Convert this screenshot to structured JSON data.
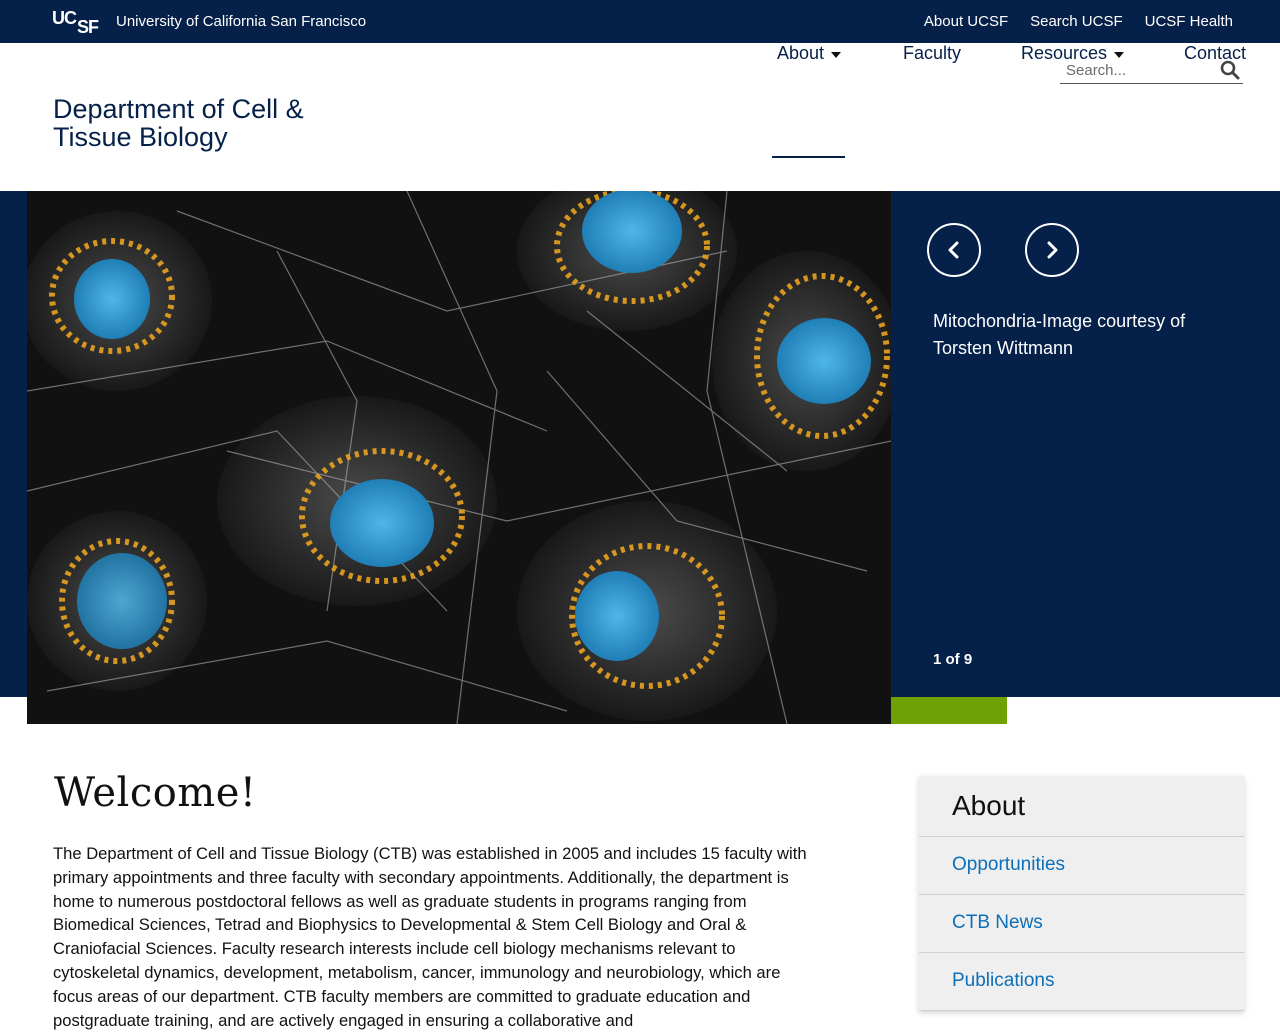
{
  "topbar": {
    "logo_text": "UCSF",
    "university": "University of California San Francisco",
    "links": [
      "About UCSF",
      "Search UCSF",
      "UCSF Health"
    ]
  },
  "header": {
    "department_title": "Department of Cell & Tissue Biology",
    "search_placeholder": "Search...",
    "nav": {
      "about": "About",
      "faculty": "Faculty",
      "resources": "Resources",
      "contact": "Contact"
    }
  },
  "hero": {
    "caption": "Mitochondria-Image courtesy of Torsten Wittmann",
    "counter": "1 of 9",
    "prev_icon": "chevron-left-icon",
    "next_icon": "chevron-right-icon"
  },
  "main": {
    "heading": "Welcome!",
    "intro": "The Department of Cell and Tissue Biology (CTB) was established in 2005 and includes 15 faculty with primary appointments and three faculty with secondary appointments.  Additionally, the department is home to numerous postdoctoral fellows as well as graduate students in programs ranging from Biomedical Sciences, Tetrad and Biophysics to Developmental & Stem Cell Biology and Oral & Craniofacial Sciences.  Faculty research interests include cell biology mechanisms relevant to cytoskeletal dynamics, development, metabolism, cancer, immunology and neurobiology, which are focus areas of our department.  CTB faculty members are committed to graduate education and postgraduate training, and are actively engaged in ensuring a collaborative and"
  },
  "sidebar": {
    "title": "About",
    "items": [
      "Opportunities",
      "CTB News",
      "Publications"
    ]
  },
  "colors": {
    "navy": "#052049",
    "green": "#6ea204",
    "link_blue": "#0d6fb8"
  }
}
